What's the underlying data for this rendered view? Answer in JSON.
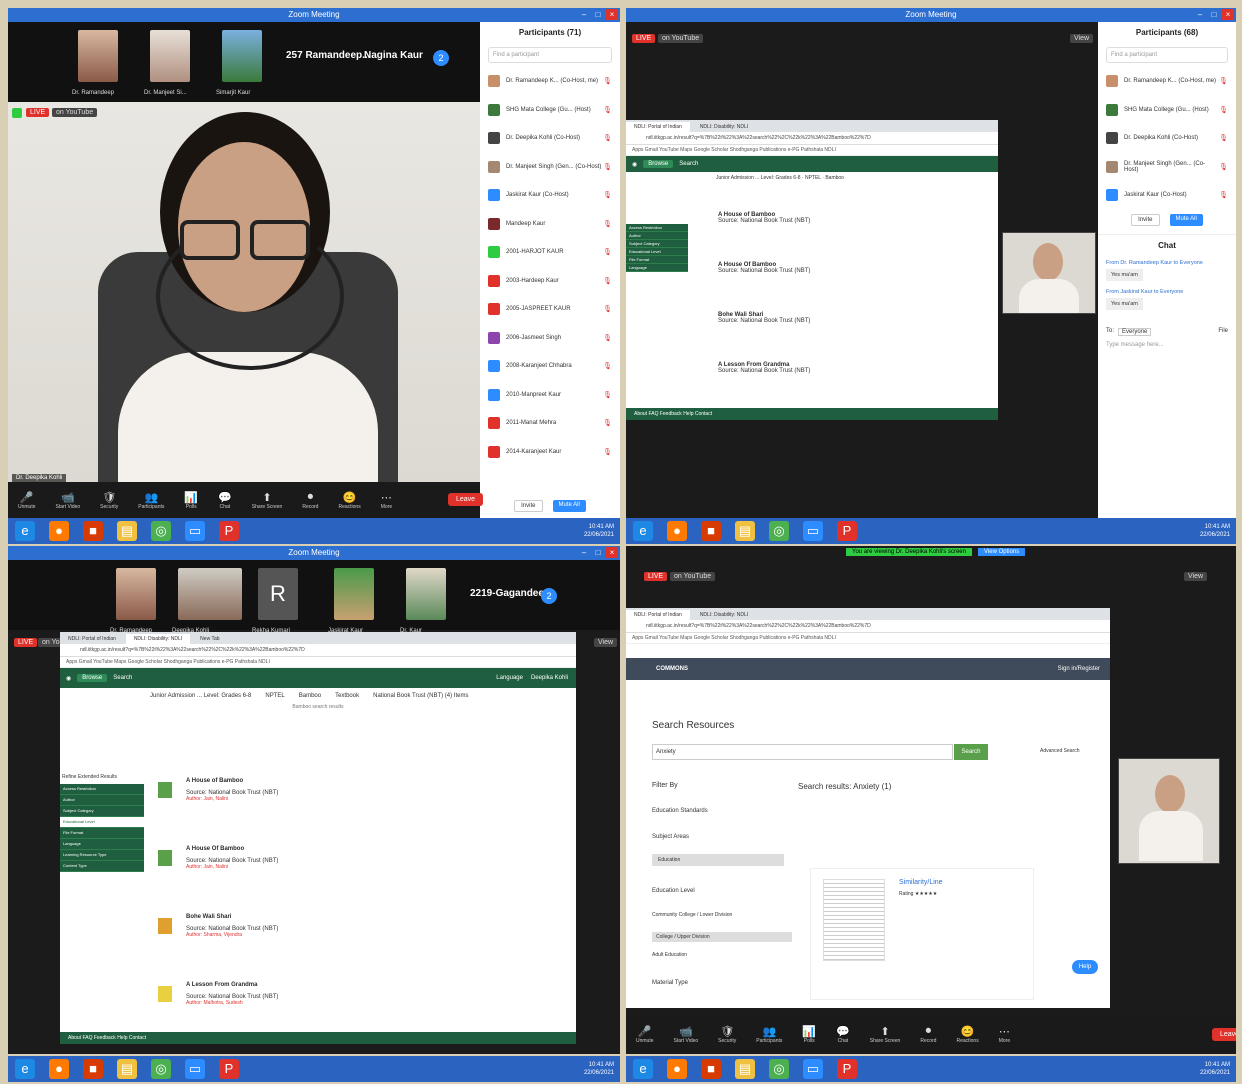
{
  "quad1": {
    "window_title": "Zoom Meeting",
    "thumbnails": [
      {
        "name": "Dr. Ramandeep"
      },
      {
        "name": "Dr. Manjeet Si..."
      },
      {
        "name": "Simarjit Kaur"
      }
    ],
    "names_row": [
      "257 Ramandeep...",
      "Nagina Kaur"
    ],
    "more_count": "2",
    "live_badge": "LIVE",
    "live_label": "on YouTube",
    "speaker_label": "Dr. Deepika Kohli",
    "participants_title": "Participants (71)",
    "search_placeholder": "Find a participant",
    "participants": [
      {
        "name": "Dr. Ramandeep K... (Co-Host, me)",
        "color": "#c78f6a"
      },
      {
        "name": "SHG Mata College (Gu... (Host)",
        "color": "#3c7a3c"
      },
      {
        "name": "Dr. Deepika Kohli (Co-Host)",
        "color": "#444444"
      },
      {
        "name": "Dr. Manjeet Singh (Gen... (Co-Host)",
        "color": "#a58872"
      },
      {
        "name": "Jaskirat Kaur (Co-Host)",
        "color": "#2d8cff"
      },
      {
        "name": "Mandeep Kaur",
        "color": "#7a2a2a"
      },
      {
        "name": "2001-HARJOT KAUR",
        "color": "#2ecc40"
      },
      {
        "name": "2003-Hardeep Kaur",
        "color": "#e0312b"
      },
      {
        "name": "2005-JASPREET KAUR",
        "color": "#e0312b"
      },
      {
        "name": "2006-Jasmeet Singh",
        "color": "#8e44ad"
      },
      {
        "name": "2008-Karanjeet Chhabra",
        "color": "#2d8cff"
      },
      {
        "name": "2010-Manpreet Kaur",
        "color": "#2d8cff"
      },
      {
        "name": "2011-Manat Mehra",
        "color": "#e0312b"
      },
      {
        "name": "2014-Karanjeet Kaur",
        "color": "#e0312b"
      }
    ],
    "invite_label": "Invite",
    "mute_all_label": "Mute All",
    "toolbar": [
      "Unmute",
      "Start Video",
      "Security",
      "Participants",
      "Polls",
      "Chat",
      "Share Screen",
      "Record",
      "Reactions",
      "More"
    ],
    "end_label": "Leave"
  },
  "quad2": {
    "window_title": "Zoom Meeting",
    "live_badge": "LIVE",
    "live_label": "on YouTube",
    "view_label": "View",
    "participants_title": "Participants (68)",
    "search_placeholder": "Find a participant",
    "participants": [
      {
        "name": "Dr. Ramandeep K... (Co-Host, me)",
        "color": "#c78f6a"
      },
      {
        "name": "SHG Mata College (Gu... (Host)",
        "color": "#3c7a3c"
      },
      {
        "name": "Dr. Deepika Kohli (Co-Host)",
        "color": "#444444"
      },
      {
        "name": "Dr. Manjeet Singh (Gen... (Co-Host)",
        "color": "#a58872"
      },
      {
        "name": "Jaskirat Kaur (Co-Host)",
        "color": "#2d8cff"
      }
    ],
    "invite_label": "Invite",
    "mute_all_label": "Mute All",
    "chat_title": "Chat",
    "chat": [
      {
        "from": "From Dr. Ramandeep Kaur to Everyone",
        "msg": "Yes ma'am"
      },
      {
        "from": "From Jaskirat Kaur to Everyone",
        "msg": "Yes ma'am"
      }
    ],
    "to_label": "To:",
    "to_value": "Everyone",
    "file_label": "File",
    "message_placeholder": "Type message here..."
  },
  "quad3": {
    "window_title": "Zoom Meeting",
    "thumbnails": [
      {
        "name": "Dr. Ramandeep"
      },
      {
        "name": "Deepika Kohli"
      },
      {
        "name": "Rekha Kumari"
      },
      {
        "name": "Jaskirat Kaur"
      },
      {
        "name": "Dr. Kaur"
      }
    ],
    "r_letter": "R",
    "names_row": [
      "2219-Gagandee..."
    ],
    "more_count": "2",
    "live_badge": "LIVE",
    "live_label": "on YouTube",
    "view_label": "View"
  },
  "quad4": {
    "share_banner": "You are viewing Dr. Deepika Kohli's screen",
    "view_options": "View Options",
    "live_badge": "LIVE",
    "live_label": "on YouTube",
    "view_label": "View",
    "commons": {
      "brand": "COMMONS",
      "search_heading": "Search Resources",
      "search_value": "Anxiety",
      "search_button": "Search",
      "advanced": "Advanced Search",
      "filter_by": "Filter By",
      "results_title": "Search results: Anxiety (1)",
      "filters": [
        "Education Standards",
        "Subject Areas",
        "Education Level",
        "Material Type"
      ],
      "subject_option": "Education",
      "level_options": [
        "Community College / Lower Division",
        "College / Upper Division",
        "Adult Education"
      ],
      "result_title": "Similarity/Line",
      "rating": "Rating ★★★★★",
      "help_label": "Help",
      "signin": "Sign in/Register"
    }
  },
  "ndl": {
    "tabs": [
      "NDLI: Portal of Indian",
      "NDLI: Disability: NDLI",
      "New Tab"
    ],
    "url": "ndl.iitkgp.ac.in/result?q=%7B%22t%22%3A%22search%22%2C%22k%22%3A%22Bamboo%22%7D",
    "bookmarks": "Apps  Gmail  YouTube  Maps  Google Scholar  Shodhganga  Publications  e-PG Pathshala  NDLI",
    "header_browse": "Browse",
    "header_search": "Search",
    "header_language": "Language",
    "header_user": "Deepika Kohli",
    "filter_chips": [
      "Junior Admission ... Level: Grades 6-8",
      "NPTEL",
      "Bamboo",
      "Textbook",
      "National Book Trust (NBT) (4) Items"
    ],
    "result_note": "Bamboo search results",
    "side_title": "Refine Extended Results",
    "side_items": [
      "Access Restriction",
      "Author",
      "Subject Category",
      "Educational Level",
      "File Format",
      "Language",
      "Learning Resource Type",
      "Content Type"
    ],
    "results": [
      {
        "title": "A House of Bamboo",
        "source": "Source: National Book Trust (NBT)",
        "author": "Author: Jain, Nalini"
      },
      {
        "title": "A House Of Bamboo",
        "source": "Source: National Book Trust (NBT)",
        "author": "Author: Jain, Nalini"
      },
      {
        "title": "Bohe Wali Shari",
        "source": "Source: National Book Trust (NBT)",
        "author": "Author: Sharma, Vijendra"
      },
      {
        "title": "A Lesson From Grandma",
        "source": "Source: National Book Trust (NBT)",
        "author": "Author: Malhotra, Sudesh"
      }
    ],
    "footer": "About  FAQ  Feedback  Help  Contact"
  },
  "taskbar": {
    "tray_time": "10:41 AM",
    "tray_date": "22/06/2021"
  },
  "colors": {
    "zoom_blue": "#2d6fd1",
    "live_red": "#e0312b",
    "ndl_green": "#1f5f3f",
    "taskbar": "#2b63c0"
  }
}
